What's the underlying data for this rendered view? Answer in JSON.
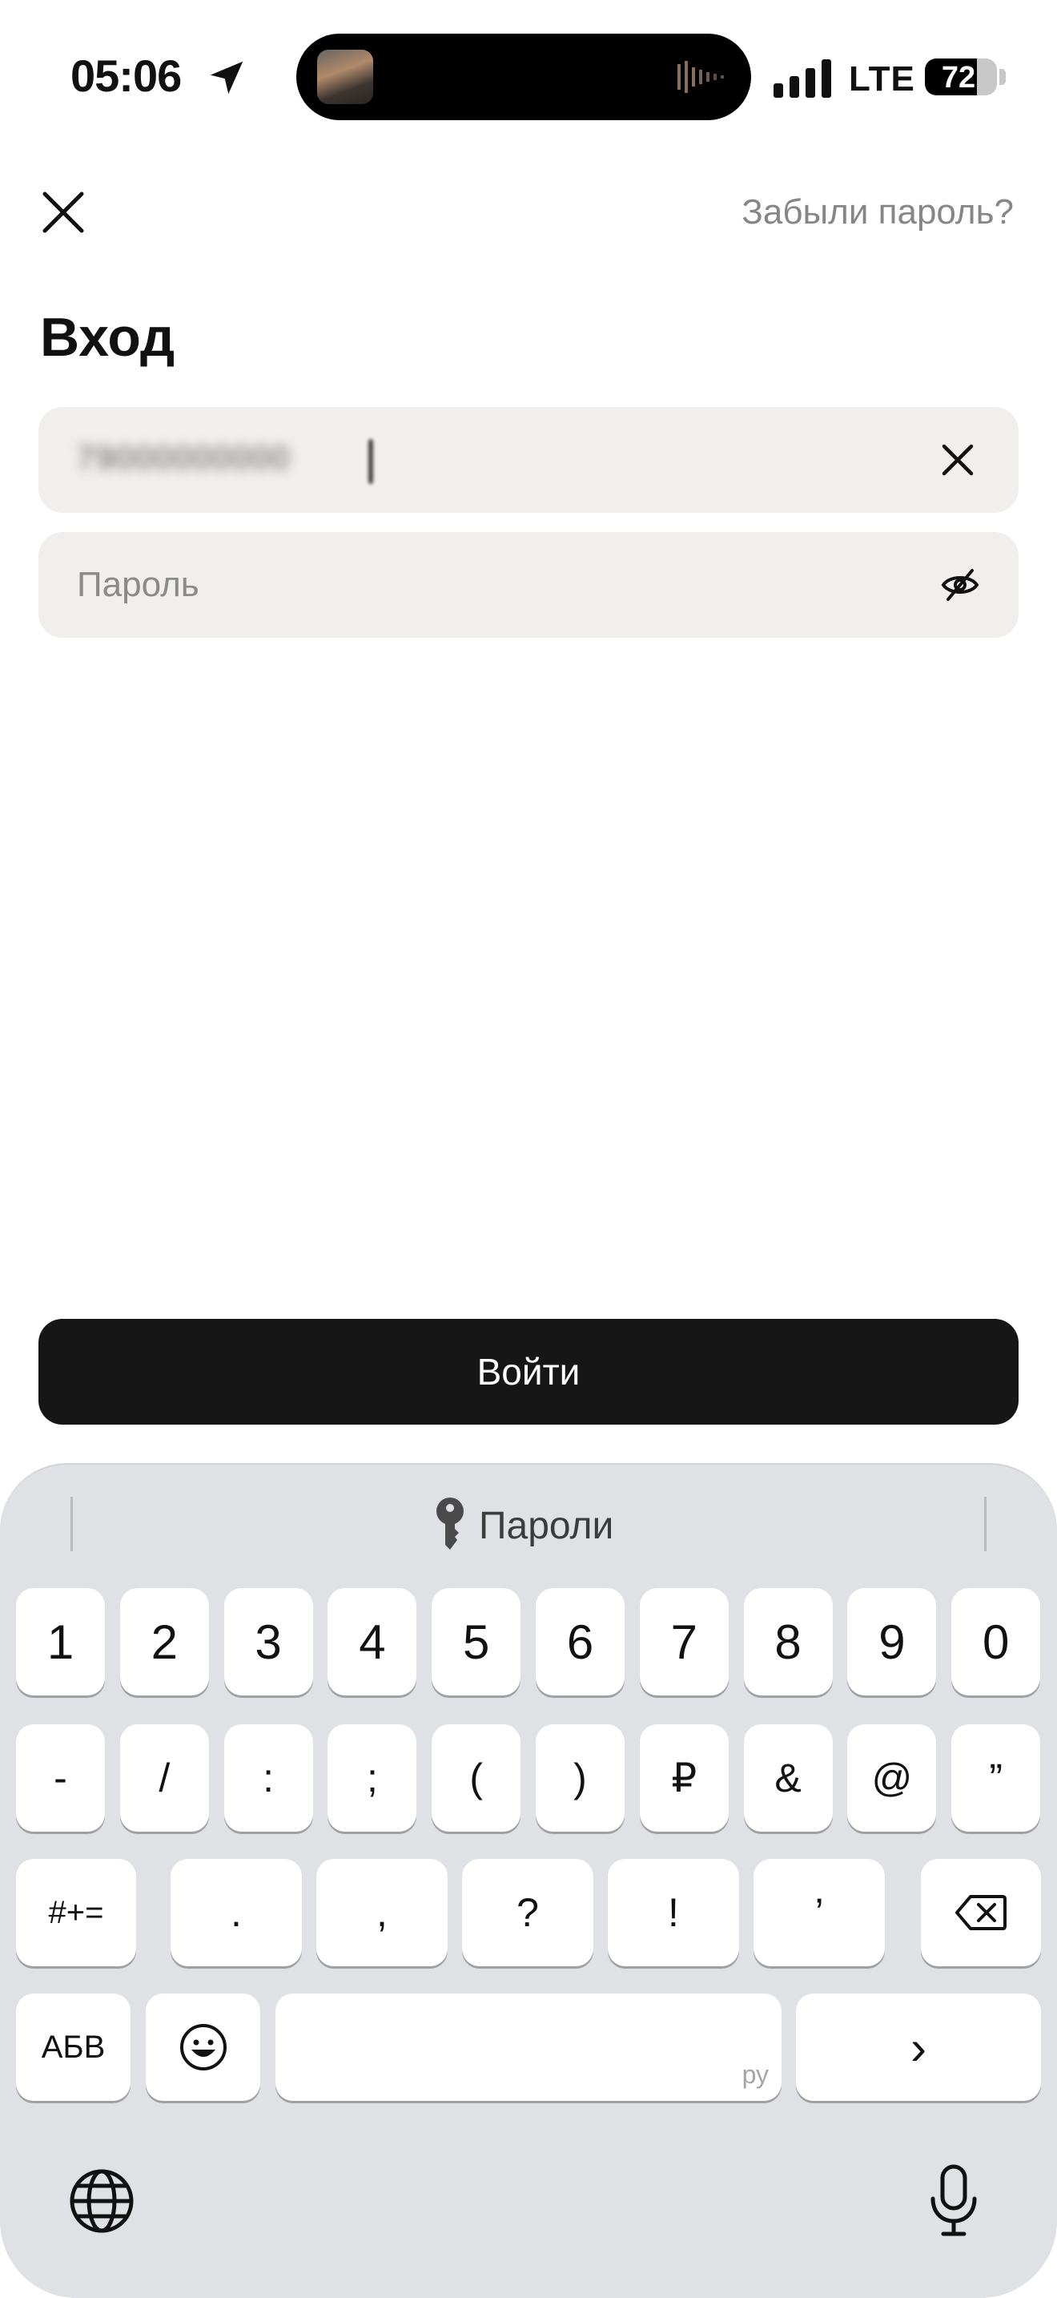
{
  "status_bar": {
    "time": "05:06",
    "network": "LTE",
    "battery_level": "72",
    "battery_fraction": 0.72,
    "icons": [
      "location-arrow-icon",
      "signal-bars-icon",
      "battery-icon"
    ]
  },
  "header": {
    "close_icon": "close-icon",
    "forgot_password": "Забыли пароль?"
  },
  "page": {
    "title": "Вход"
  },
  "form": {
    "login_value": "79000000000",
    "password_placeholder": "Пароль",
    "clear_icon": "clear-icon",
    "visibility_icon": "eye-slash-icon"
  },
  "submit_label": "Войти",
  "colors": {
    "accent_button": "#161616",
    "field_bg": "#f0efed",
    "muted_text": "#868686"
  },
  "keyboard": {
    "suggestion": "Пароли",
    "row1": [
      "1",
      "2",
      "3",
      "4",
      "5",
      "6",
      "7",
      "8",
      "9",
      "0"
    ],
    "row2": [
      "-",
      "/",
      ":",
      ";",
      "(",
      ")",
      "₽",
      "&",
      "@",
      "”"
    ],
    "row3": {
      "toggle": "#+=",
      "keys": [
        ".",
        ",",
        "?",
        "!",
        "’"
      ]
    },
    "row4": {
      "alphabet": "АБВ",
      "space_hint": "ру",
      "return": "›"
    }
  }
}
